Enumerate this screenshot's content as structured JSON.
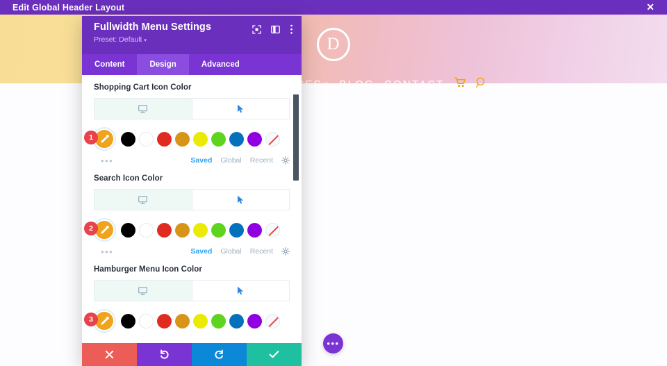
{
  "topbar": {
    "title": "Edit Global Header Layout",
    "close_icon": "close-icon",
    "close_glyph": "✕",
    "background": "#6b2fbd"
  },
  "site_preview": {
    "logo_letter": "D",
    "nav_items": [
      {
        "label": "ICES",
        "has_caret": true
      },
      {
        "label": "BLOG",
        "has_caret": false
      },
      {
        "label": "CONTACT",
        "has_caret": false
      }
    ],
    "caret_glyph": "▾",
    "cart_icon": "shopping-cart-icon",
    "cart_glyph": "🛒",
    "search_icon": "search-icon",
    "search_glyph": "⚲",
    "icon_color": "#f0a500"
  },
  "modal": {
    "title": "Fullwidth Menu Settings",
    "preset_label": "Preset: Default",
    "preset_caret": "▾",
    "header_icons": [
      {
        "name": "fullscreen-icon"
      },
      {
        "name": "split-view-icon"
      },
      {
        "name": "more-options-icon"
      }
    ],
    "tabs": [
      {
        "label": "Content",
        "active": false
      },
      {
        "label": "Design",
        "active": true
      },
      {
        "label": "Advanced",
        "active": false
      }
    ],
    "fields": [
      {
        "badge": "1",
        "label": "Shopping Cart Icon Color",
        "responsive": [
          {
            "name": "desktop-view-tab",
            "icon": "desktop-icon",
            "selected": true
          },
          {
            "name": "hover-state-tab",
            "icon": "cursor-icon",
            "selected": false
          }
        ],
        "eyedropper": {
          "name": "eyedropper-button",
          "color": "#f0a41c"
        },
        "swatches": [
          {
            "name": "swatch-black",
            "color": "#000000"
          },
          {
            "name": "swatch-white",
            "color": "#ffffff"
          },
          {
            "name": "swatch-red",
            "color": "#e02b20"
          },
          {
            "name": "swatch-orange",
            "color": "#d79418"
          },
          {
            "name": "swatch-yellow",
            "color": "#eaea05"
          },
          {
            "name": "swatch-green",
            "color": "#5fd41f"
          },
          {
            "name": "swatch-blue",
            "color": "#0571bd"
          },
          {
            "name": "swatch-purple",
            "color": "#9000e0"
          },
          {
            "name": "swatch-transparent",
            "color": "none"
          }
        ],
        "more_dots": "•••",
        "links": [
          {
            "label": "Saved",
            "active": true
          },
          {
            "label": "Global",
            "active": false
          },
          {
            "label": "Recent",
            "active": false
          }
        ],
        "gear": "settings-gear-icon"
      },
      {
        "badge": "2",
        "label": "Search Icon Color",
        "responsive": [
          {
            "name": "desktop-view-tab",
            "icon": "desktop-icon",
            "selected": true
          },
          {
            "name": "hover-state-tab",
            "icon": "cursor-icon",
            "selected": false
          }
        ],
        "eyedropper": {
          "name": "eyedropper-button",
          "color": "#f0a41c"
        },
        "swatches": [
          {
            "name": "swatch-black",
            "color": "#000000"
          },
          {
            "name": "swatch-white",
            "color": "#ffffff"
          },
          {
            "name": "swatch-red",
            "color": "#e02b20"
          },
          {
            "name": "swatch-orange",
            "color": "#d79418"
          },
          {
            "name": "swatch-yellow",
            "color": "#eaea05"
          },
          {
            "name": "swatch-green",
            "color": "#5fd41f"
          },
          {
            "name": "swatch-blue",
            "color": "#0571bd"
          },
          {
            "name": "swatch-purple",
            "color": "#9000e0"
          },
          {
            "name": "swatch-transparent",
            "color": "none"
          }
        ],
        "more_dots": "•••",
        "links": [
          {
            "label": "Saved",
            "active": true
          },
          {
            "label": "Global",
            "active": false
          },
          {
            "label": "Recent",
            "active": false
          }
        ],
        "gear": "settings-gear-icon"
      },
      {
        "badge": "3",
        "label": "Hamburger Menu Icon Color",
        "responsive": [
          {
            "name": "desktop-view-tab",
            "icon": "desktop-icon",
            "selected": true
          },
          {
            "name": "hover-state-tab",
            "icon": "cursor-icon",
            "selected": false
          }
        ],
        "eyedropper": {
          "name": "eyedropper-button",
          "color": "#f0a41c"
        },
        "swatches": [
          {
            "name": "swatch-black",
            "color": "#000000"
          },
          {
            "name": "swatch-white",
            "color": "#ffffff"
          },
          {
            "name": "swatch-red",
            "color": "#e02b20"
          },
          {
            "name": "swatch-orange",
            "color": "#d79418"
          },
          {
            "name": "swatch-yellow",
            "color": "#eaea05"
          },
          {
            "name": "swatch-green",
            "color": "#5fd41f"
          },
          {
            "name": "swatch-blue",
            "color": "#0571bd"
          },
          {
            "name": "swatch-purple",
            "color": "#9000e0"
          },
          {
            "name": "swatch-transparent",
            "color": "none"
          }
        ],
        "more_dots": "•••",
        "links": [],
        "gear": "settings-gear-icon"
      }
    ],
    "footer": [
      {
        "name": "cancel-button",
        "icon": "close-icon",
        "glyph": "✖",
        "color": "#eb5d56",
        "class": "cancel"
      },
      {
        "name": "undo-button",
        "icon": "undo-icon",
        "glyph": "↺",
        "color": "#7b34d4",
        "class": "undo"
      },
      {
        "name": "redo-button",
        "icon": "redo-icon",
        "glyph": "↻",
        "color": "#0c88d8",
        "class": "redo"
      },
      {
        "name": "save-button",
        "icon": "checkmark-icon",
        "glyph": "✔",
        "color": "#1fc0a0",
        "class": "save"
      }
    ]
  },
  "fab": {
    "name": "more-actions-fab",
    "glyph": "•••",
    "color": "#7b34d4"
  }
}
